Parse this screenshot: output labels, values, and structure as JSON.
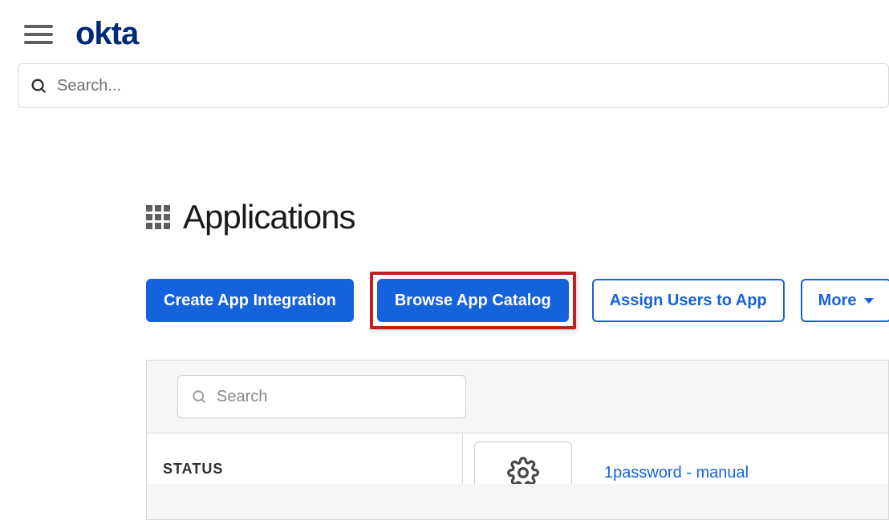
{
  "header": {
    "logo_text": "okta"
  },
  "global_search": {
    "placeholder": "Search..."
  },
  "page": {
    "title": "Applications"
  },
  "buttons": {
    "create": "Create App Integration",
    "browse": "Browse App Catalog",
    "assign": "Assign Users to App",
    "more": "More"
  },
  "panel": {
    "search_placeholder": "Search",
    "status_label": "STATUS",
    "app_link_text": "1password - manual"
  }
}
